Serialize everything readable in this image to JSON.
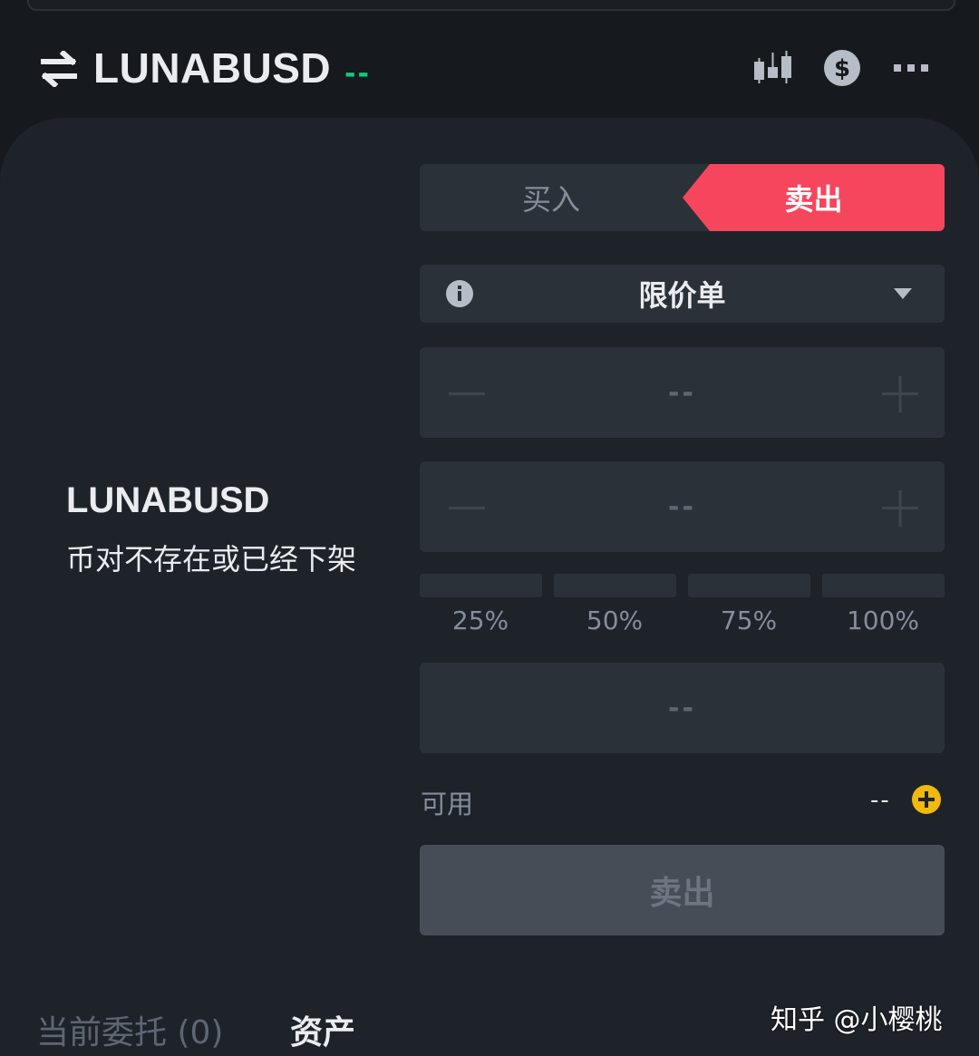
{
  "header": {
    "symbol": "LUNABUSD",
    "change": "--"
  },
  "left": {
    "symbol": "LUNABUSD",
    "message": "币对不存在或已经下架"
  },
  "side_tabs": {
    "buy_label": "买入",
    "sell_label": "卖出",
    "active": "sell"
  },
  "order_type": {
    "selected": "限价单"
  },
  "price_input": {
    "value": "--"
  },
  "amount_input": {
    "value": "--"
  },
  "percent_options": [
    "25%",
    "50%",
    "75%",
    "100%"
  ],
  "total_input": {
    "value": "--"
  },
  "available": {
    "label": "可用",
    "value": "--"
  },
  "submit": {
    "label": "卖出"
  },
  "bottom_tabs": {
    "orders_label": "当前委托 (0)",
    "assets_label": "资产"
  },
  "watermark": "知乎 @小樱桃",
  "colors": {
    "background": "#161a1e",
    "panel": "#1e2329",
    "input": "#2b3139",
    "sell": "#f6465d",
    "positive": "#0ecb81",
    "accent": "#f0b90b",
    "disabled_button": "#474d57"
  },
  "icons": {
    "swap": "swap-arrows-icon",
    "chart": "candlestick-icon",
    "currency": "dollar-icon",
    "more": "more-dots-icon",
    "info": "info-icon",
    "dropdown": "caret-down-icon",
    "decrement": "minus-icon",
    "increment": "plus-icon",
    "add_funds": "add-circle-icon"
  }
}
